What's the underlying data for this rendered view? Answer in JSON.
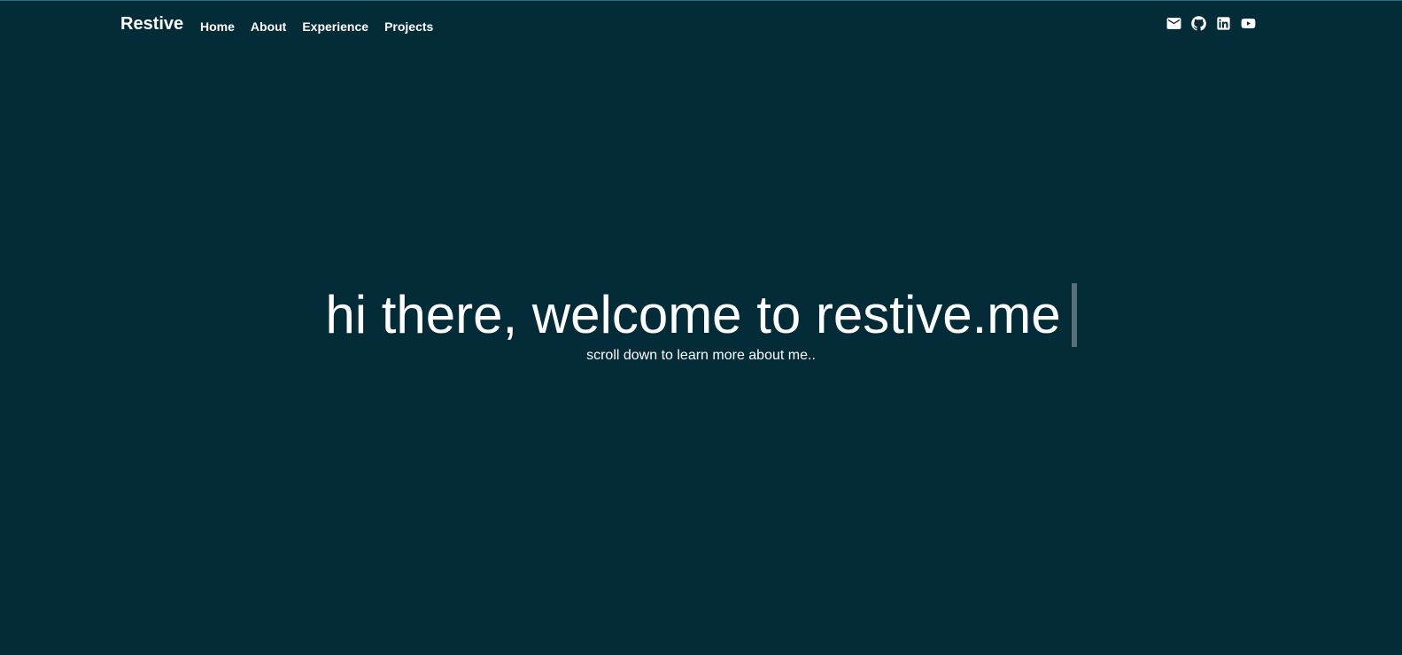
{
  "nav": {
    "brand": "Restive",
    "links": [
      {
        "label": "Home"
      },
      {
        "label": "About"
      },
      {
        "label": "Experience"
      },
      {
        "label": "Projects"
      }
    ],
    "social": [
      {
        "icon": "mail-icon"
      },
      {
        "icon": "github-icon"
      },
      {
        "icon": "linkedin-icon"
      },
      {
        "icon": "youtube-icon"
      }
    ]
  },
  "hero": {
    "title": "hi there, welcome to restive.me",
    "subtitle": "scroll down to learn more about me.."
  },
  "colors": {
    "background": "#032b38",
    "text": "#ffffff",
    "caret": "#5b6f78"
  }
}
